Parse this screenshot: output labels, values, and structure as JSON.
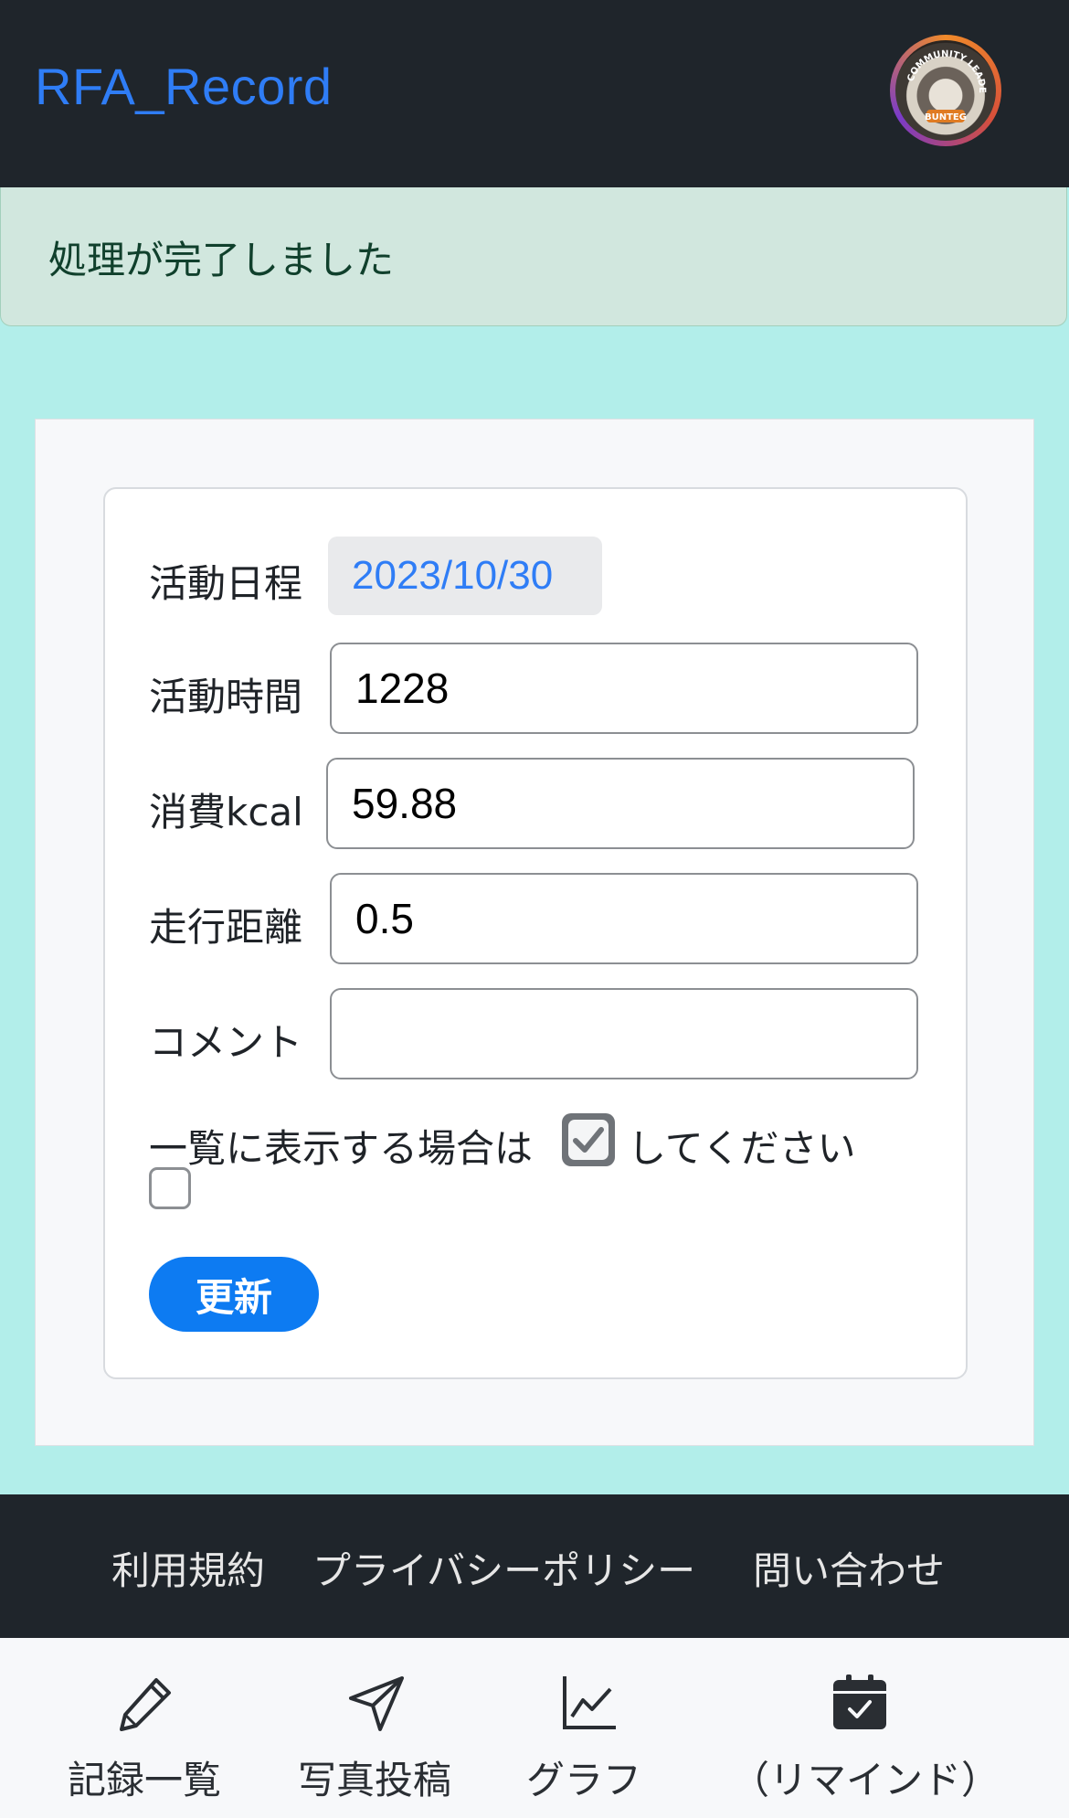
{
  "header": {
    "brand": "RFA_Record",
    "avatar_badge_top": "COMMUNITY LEADER",
    "avatar_badge_bottom": "BUNTEG"
  },
  "alert": {
    "message": "処理が完了しました"
  },
  "form": {
    "date_label": "活動日程",
    "date_value": "2023/10/30",
    "time_label": "活動時間",
    "time_value": "1228",
    "kcal_label": "消費kcal",
    "kcal_value": "59.88",
    "distance_label": "走行距離",
    "distance_value": "0.5",
    "comment_label": "コメント",
    "comment_value": "",
    "public_hint_before": "一覧に表示する場合は",
    "public_hint_after": "してください",
    "public_checked": false,
    "submit_label": "更新"
  },
  "footer": {
    "terms": "利用規約",
    "privacy": "プライバシーポリシー",
    "contact": "問い合わせ"
  },
  "bottom_nav": {
    "records": {
      "label": "記録一覧",
      "icon": "pencil-icon"
    },
    "photo": {
      "label": "写真投稿",
      "icon": "send-icon"
    },
    "graph": {
      "label": "グラフ",
      "icon": "graph-icon"
    },
    "remind": {
      "label": "（リマインド）",
      "icon": "calendar-check-icon"
    }
  },
  "colors": {
    "accent": "#0d7bf2",
    "brand_link": "#2f7df6",
    "background": "#b2eeea",
    "header_bg": "#1f252b",
    "alert_bg": "#d1e7de"
  }
}
